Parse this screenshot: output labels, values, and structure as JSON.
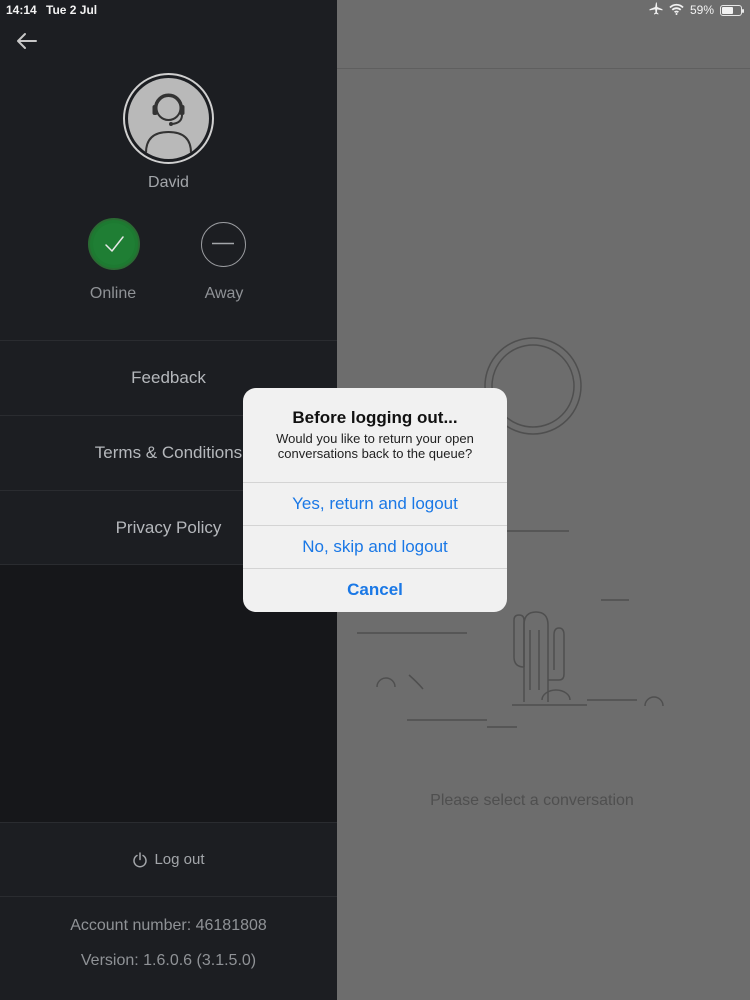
{
  "status_bar": {
    "time": "14:14",
    "date": "Tue 2 Jul",
    "battery_percent": "59%",
    "icons": [
      "airplane-icon",
      "wifi-icon",
      "battery-icon"
    ]
  },
  "sidebar": {
    "back_icon": "arrow-left-icon",
    "user_name": "David",
    "status_options": [
      {
        "label": "Online",
        "icon": "checkmark-icon",
        "selected": true
      },
      {
        "label": "Away",
        "icon": "minus-icon",
        "selected": false
      }
    ],
    "menu": [
      {
        "label": "Feedback"
      },
      {
        "label": "Terms & Conditions"
      },
      {
        "label": "Privacy Policy"
      }
    ],
    "logout_label": "Log out",
    "account_number": "Account number: 46181808",
    "version": "Version: 1.6.0.6 (3.1.5.0)"
  },
  "main": {
    "empty_text": "Please select a conversation"
  },
  "dialog": {
    "title": "Before logging out...",
    "message": "Would you like to return your open conversations back to the queue?",
    "buttons": {
      "yes": "Yes, return and logout",
      "no": "No, skip and logout",
      "cancel": "Cancel"
    }
  },
  "colors": {
    "sidebar_bg": "#1c1e22",
    "online_green": "#1d7a31",
    "dialog_action_blue": "#1a78e6",
    "overlay_gray": "#6d6d6d"
  }
}
